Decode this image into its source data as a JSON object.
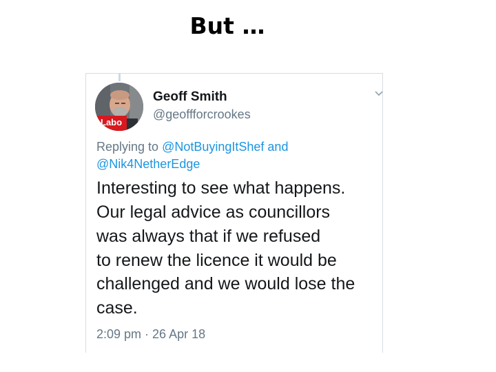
{
  "slide": {
    "title": "But …"
  },
  "tweet": {
    "author": {
      "display_name": "Geoff Smith",
      "handle": "@geoffforcrookes",
      "avatar_badge_text": "Labo"
    },
    "reply": {
      "prefix": "Replying to ",
      "mention_1": "@NotBuyingItShef",
      "connector": " and",
      "mention_2": "@Nik4NetherEdge"
    },
    "text_lines": [
      "Interesting to see what happens.",
      "Our legal advice as councillors",
      "was always that if we refused",
      "to renew the licence it would be",
      "challenged and we would lose the",
      "case."
    ],
    "timestamp": "2:09 pm · 26 Apr 18",
    "icons": {
      "menu": "chevron-down-icon"
    },
    "colors": {
      "mention": "#1b95e0",
      "muted": "#657786",
      "text": "#14171a",
      "badge": "#d7191f"
    }
  }
}
